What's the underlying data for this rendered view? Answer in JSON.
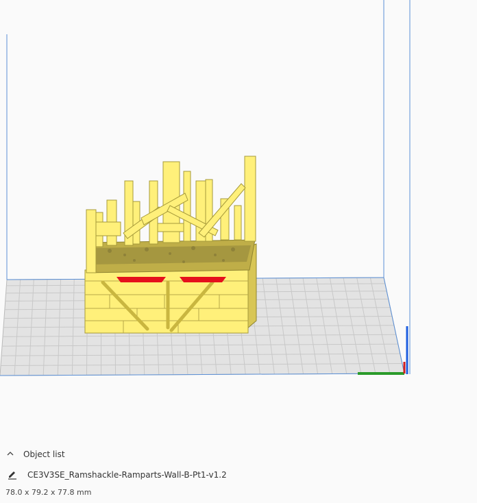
{
  "object_list": {
    "toggle_label": "Object list",
    "object_name": "CE3V3SE_Ramshackle-Ramparts-Wall-B-Pt1-v1.2",
    "dimensions": "78.0 x 79.2 x 77.8 mm"
  },
  "icons": {
    "collapse": "chevron-up-icon",
    "edit": "pencil-icon"
  },
  "colors": {
    "model_fill": "#fff07a",
    "model_shadow": "#c9b640",
    "overhang_highlight": "#e5101c",
    "build_plate": "#e3e3e3",
    "grid_line": "#c8c8c8",
    "volume_edge": "#5a8fd6",
    "axis_x": "#d11f1f",
    "axis_y": "#2a9a2a",
    "axis_z": "#1e5fe0"
  }
}
